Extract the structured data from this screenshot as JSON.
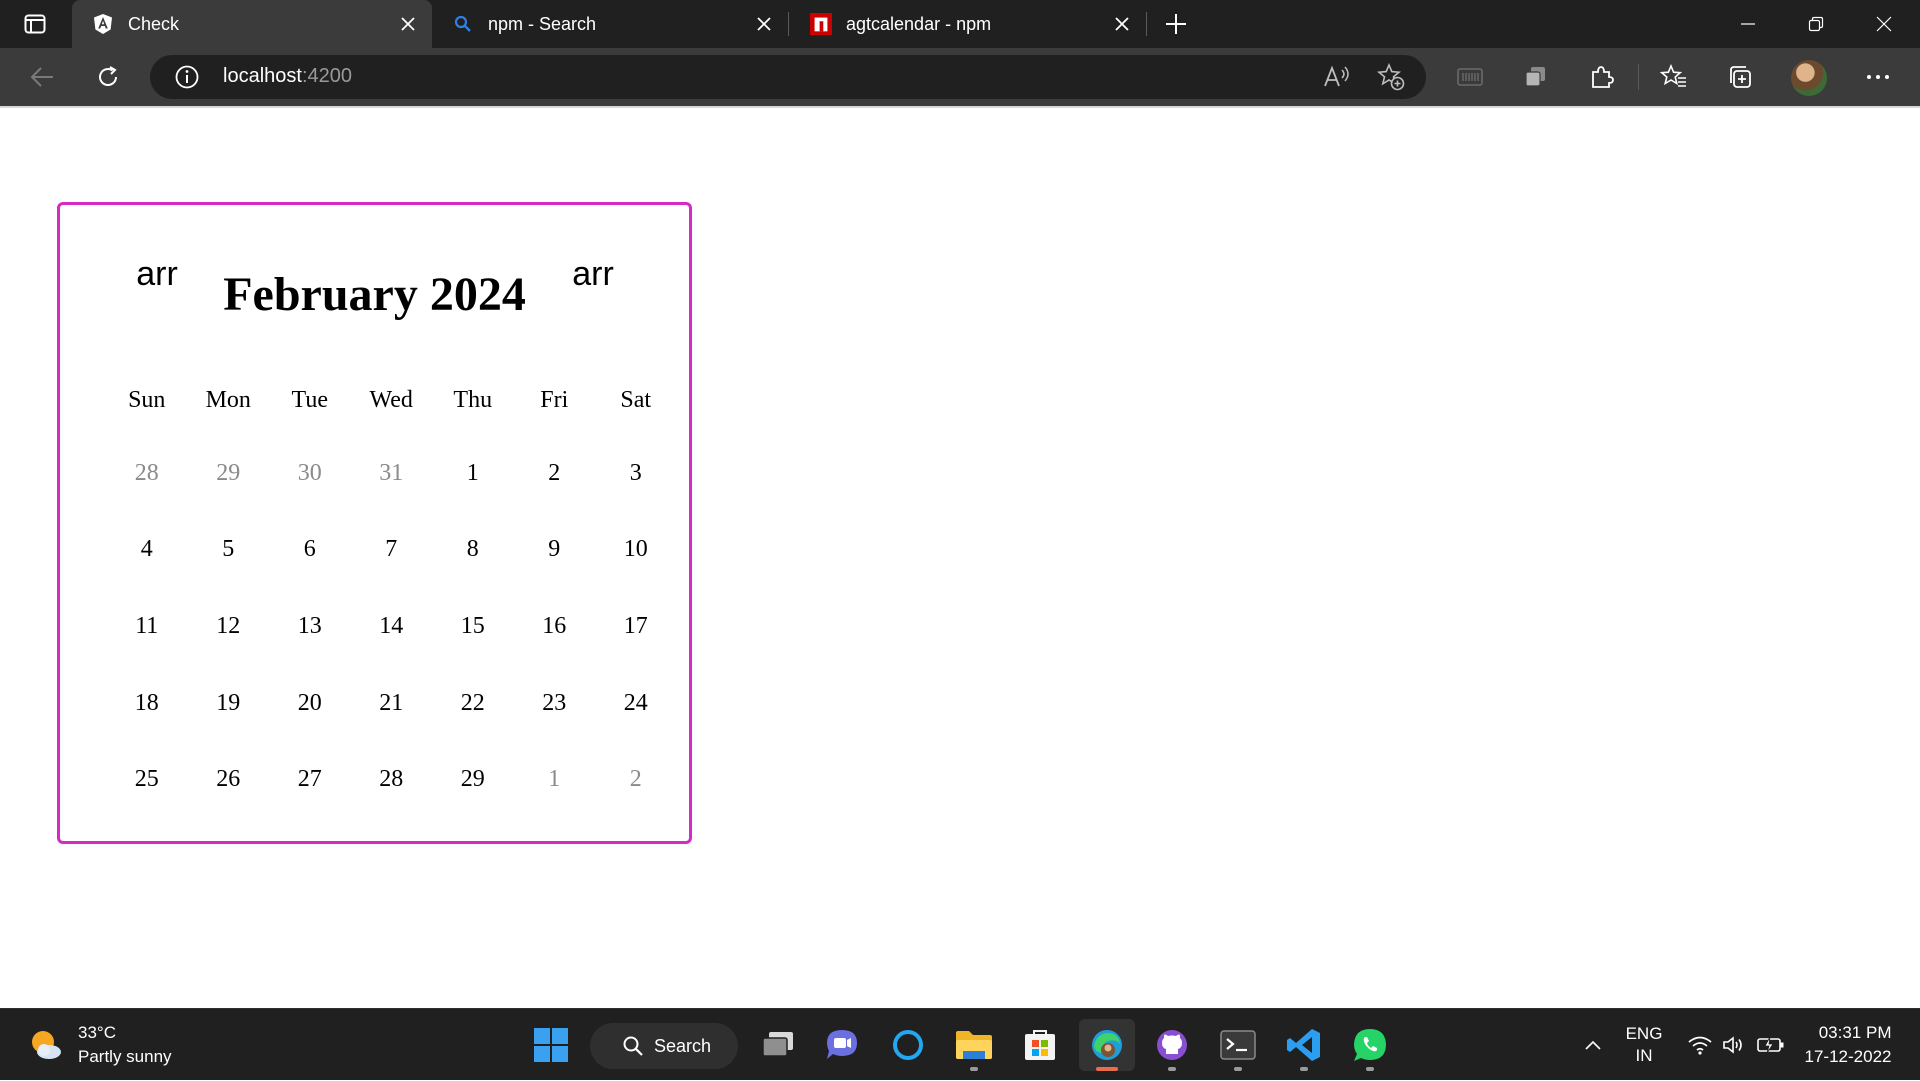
{
  "browser": {
    "tabs": [
      {
        "title": "Check",
        "favicon": "angular-icon",
        "active": true
      },
      {
        "title": "npm - Search",
        "favicon": "search-icon",
        "active": false
      },
      {
        "title": "agtcalendar - npm",
        "favicon": "npm-icon",
        "active": false
      }
    ],
    "address": {
      "host": "localhost",
      "port": ":4200"
    }
  },
  "calendar": {
    "nav_prev_label": "arr",
    "nav_next_label": "arr",
    "title": "February 2024",
    "weekdays": [
      "Sun",
      "Mon",
      "Tue",
      "Wed",
      "Thu",
      "Fri",
      "Sat"
    ],
    "weeks": [
      [
        "28",
        "29",
        "30",
        "31",
        "1",
        "2",
        "3"
      ],
      [
        "4",
        "5",
        "6",
        "7",
        "8",
        "9",
        "10"
      ],
      [
        "11",
        "12",
        "13",
        "14",
        "15",
        "16",
        "17"
      ],
      [
        "18",
        "19",
        "20",
        "21",
        "22",
        "23",
        "24"
      ],
      [
        "25",
        "26",
        "27",
        "28",
        "29",
        "1",
        "2"
      ]
    ],
    "muted": [
      [
        true,
        true,
        true,
        true,
        false,
        false,
        false
      ],
      [
        false,
        false,
        false,
        false,
        false,
        false,
        false
      ],
      [
        false,
        false,
        false,
        false,
        false,
        false,
        false
      ],
      [
        false,
        false,
        false,
        false,
        false,
        false,
        false
      ],
      [
        false,
        false,
        false,
        false,
        false,
        true,
        true
      ]
    ],
    "border_color": "#d42bc7"
  },
  "taskbar": {
    "weather": {
      "temp": "33°C",
      "condition": "Partly sunny"
    },
    "search_label": "Search",
    "language": {
      "line1": "ENG",
      "line2": "IN"
    },
    "clock": {
      "time": "03:31 PM",
      "date": "17-12-2022"
    }
  }
}
